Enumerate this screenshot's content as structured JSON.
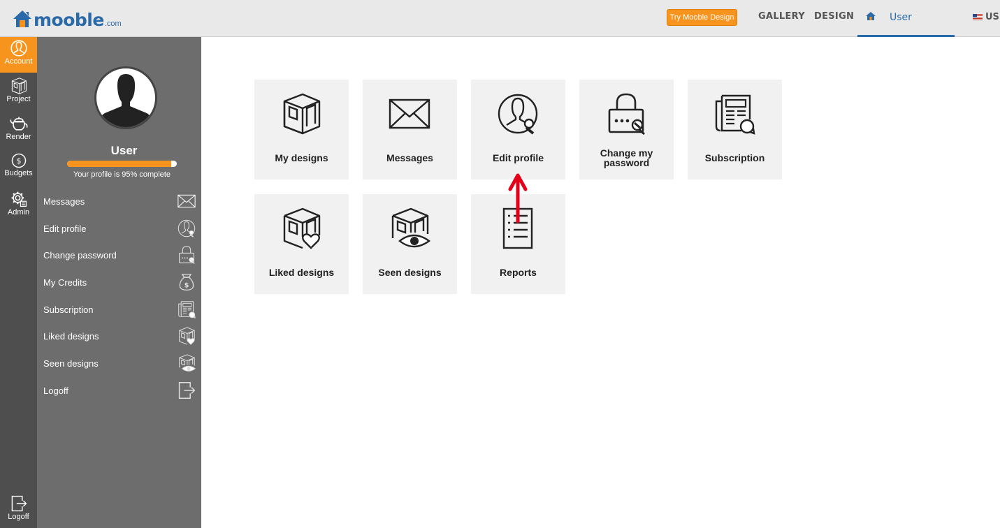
{
  "header": {
    "logo_word": "mooble",
    "logo_domain": ".com",
    "try_button": "Try Mooble Design",
    "nav": {
      "gallery": "GALLERY",
      "design": "DESIGN",
      "user": "User"
    },
    "language": "US",
    "accent_color": "#f7941d",
    "brand_color": "#2a6aa8"
  },
  "rail": {
    "items": [
      {
        "label": "Account",
        "icon": "user-circle-icon",
        "active": true
      },
      {
        "label": "Project",
        "icon": "room-cube-icon"
      },
      {
        "label": "Render",
        "icon": "teapot-icon"
      },
      {
        "label": "Budgets",
        "icon": "dollar-coin-icon"
      },
      {
        "label": "Admin",
        "icon": "gear-icon"
      }
    ],
    "logoff": "Logoff"
  },
  "profile": {
    "name": "User",
    "completion_percent": 95,
    "completion_text": "Your profile is 95% complete"
  },
  "menu": [
    {
      "label": "Messages",
      "icon": "envelope-icon"
    },
    {
      "label": "Edit profile",
      "icon": "user-wrench-icon"
    },
    {
      "label": "Change password",
      "icon": "padlock-icon"
    },
    {
      "label": "My Credits",
      "icon": "money-bag-icon"
    },
    {
      "label": "Subscription",
      "icon": "newspaper-refresh-icon"
    },
    {
      "label": "Liked designs",
      "icon": "room-heart-icon"
    },
    {
      "label": "Seen designs",
      "icon": "room-eye-icon"
    },
    {
      "label": "Logoff",
      "icon": "exit-icon"
    }
  ],
  "tiles": [
    {
      "label": "My designs",
      "icon": "room-cube-icon"
    },
    {
      "label": "Messages",
      "icon": "envelope-icon"
    },
    {
      "label": "Edit profile",
      "icon": "user-wrench-icon"
    },
    {
      "label_line1": "Change my",
      "label_line2": "password",
      "icon": "padlock-icon"
    },
    {
      "label": "Subscription",
      "icon": "newspaper-refresh-icon"
    },
    {
      "label": "Liked designs",
      "icon": "room-heart-icon"
    },
    {
      "label": "Seen designs",
      "icon": "room-eye-icon"
    },
    {
      "label": "Reports",
      "icon": "report-list-icon"
    }
  ]
}
